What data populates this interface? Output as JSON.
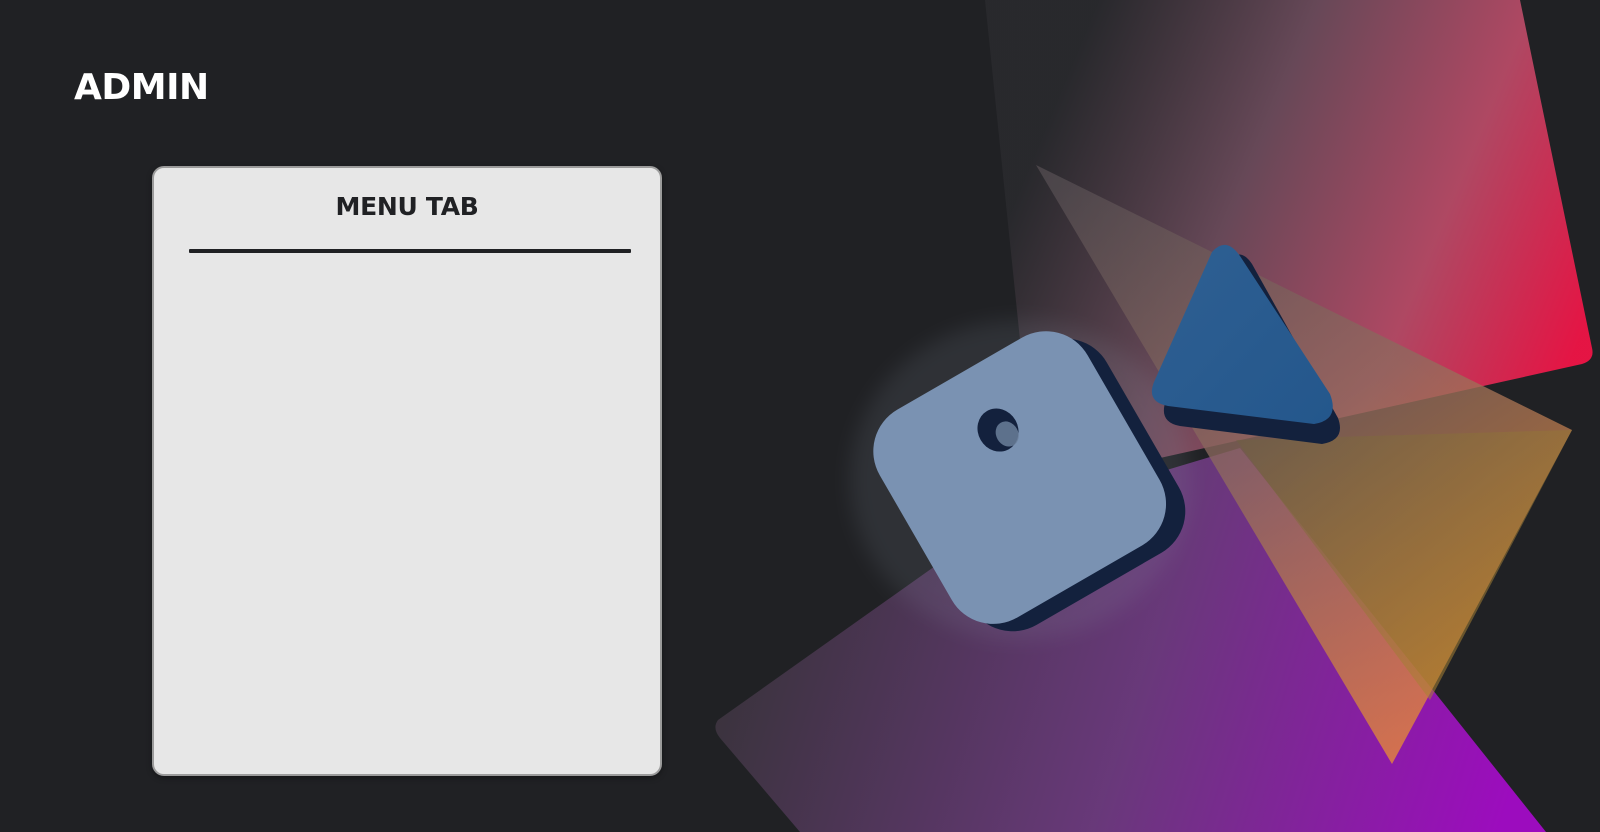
{
  "header": {
    "app_title": "ADMIN"
  },
  "menu_panel": {
    "heading": "MENU TAB",
    "items": []
  },
  "colors": {
    "background": "#202124",
    "card_background": "#e7e7e7",
    "card_border": "#9b9b9b",
    "text_dark": "#202124",
    "text_light": "#ffffff",
    "accent_pink": "#ef1446",
    "accent_purple": "#a30bc6",
    "accent_orange": "#e88a36",
    "shape_blue": "#5b7ca6",
    "shape_blue_dark": "#13213d"
  },
  "decorative_shapes": [
    "pink-gradient-panel-shape",
    "orange-gradient-triangle-shape",
    "purple-gradient-panel-shape",
    "rounded-cube-shape",
    "rounded-triangle-shape"
  ]
}
